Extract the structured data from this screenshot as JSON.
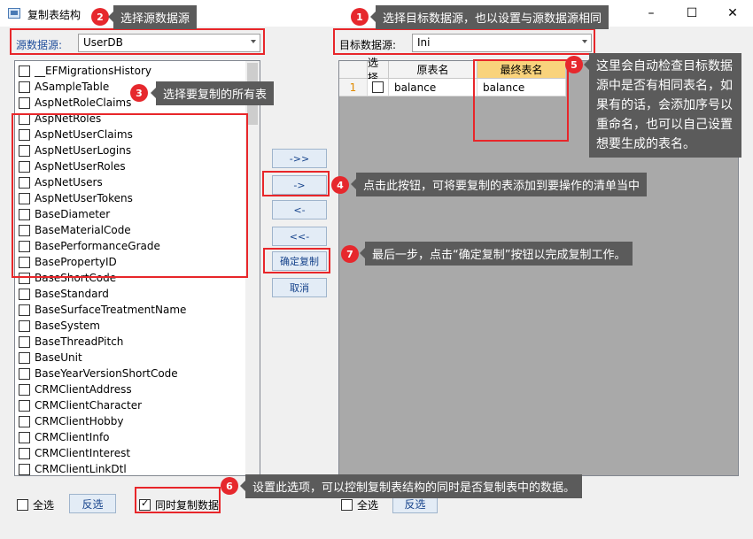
{
  "window": {
    "title": "复制表结构",
    "minimize": "–",
    "maximize": "☐",
    "close": "✕"
  },
  "source": {
    "label": "源数据源:",
    "value": "UserDB"
  },
  "target": {
    "label": "目标数据源:",
    "value": "Ini"
  },
  "tables": [
    {
      "name": "__EFMigrationsHistory",
      "checked": false
    },
    {
      "name": "ASampleTable",
      "checked": false
    },
    {
      "name": "AspNetRoleClaims",
      "checked": false
    },
    {
      "name": "AspNetRoles",
      "checked": false
    },
    {
      "name": "AspNetUserClaims",
      "checked": false
    },
    {
      "name": "AspNetUserLogins",
      "checked": false
    },
    {
      "name": "AspNetUserRoles",
      "checked": false
    },
    {
      "name": "AspNetUsers",
      "checked": false
    },
    {
      "name": "AspNetUserTokens",
      "checked": false
    },
    {
      "name": "BaseDiameter",
      "checked": false
    },
    {
      "name": "BaseMaterialCode",
      "checked": false
    },
    {
      "name": "BasePerformanceGrade",
      "checked": false
    },
    {
      "name": "BasePropertyID",
      "checked": false
    },
    {
      "name": "BaseShortCode",
      "checked": false
    },
    {
      "name": "BaseStandard",
      "checked": false
    },
    {
      "name": "BaseSurfaceTreatmentName",
      "checked": false
    },
    {
      "name": "BaseSystem",
      "checked": false
    },
    {
      "name": "BaseThreadPitch",
      "checked": false
    },
    {
      "name": "BaseUnit",
      "checked": false
    },
    {
      "name": "BaseYearVersionShortCode",
      "checked": false
    },
    {
      "name": "CRMClientAddress",
      "checked": false
    },
    {
      "name": "CRMClientCharacter",
      "checked": false
    },
    {
      "name": "CRMClientHobby",
      "checked": false
    },
    {
      "name": "CRMClientInfo",
      "checked": false
    },
    {
      "name": "CRMClientInterest",
      "checked": false
    },
    {
      "name": "CRMClientLinkDtl",
      "checked": false
    }
  ],
  "buttons": {
    "add_all": "->>",
    "add": "->",
    "remove": "<-",
    "remove_all": "<<-",
    "confirm": "确定复制",
    "cancel": "取消"
  },
  "grid": {
    "headers": {
      "select": "选择",
      "source_name": "原表名",
      "final_name": "最终表名"
    },
    "rows": [
      {
        "index": "1",
        "selected": false,
        "source_name": "balance",
        "final_name": "balance"
      }
    ]
  },
  "bottom": {
    "select_all": "全选",
    "invert": "反选",
    "copy_data": "同时复制数据",
    "copy_data_checked": true,
    "select_all_right": "全选",
    "invert_right": "反选"
  },
  "annotations": [
    {
      "num": "1",
      "text": "选择目标数据源，也以设置与源数据源相同"
    },
    {
      "num": "2",
      "text": "选择源数据源"
    },
    {
      "num": "3",
      "text": "选择要复制的所有表"
    },
    {
      "num": "4",
      "text": "点击此按钮，可将要复制的表添加到要操作的清单当中"
    },
    {
      "num": "5",
      "text": "这里会自动检查目标数据源中是否有相同表名，如果有的话，会添加序号以重命名，也可以自己设置想要生成的表名。"
    },
    {
      "num": "6",
      "text": "设置此选项，可以控制复制表结构的同时是否复制表中的数据。"
    },
    {
      "num": "7",
      "text": "最后一步，点击“确定复制”按钮以完成复制工作。"
    }
  ],
  "colors": {
    "annotation_red": "#e6282d",
    "tip_bg": "#5b5b5b",
    "highlight_header": "#f9d37c"
  }
}
